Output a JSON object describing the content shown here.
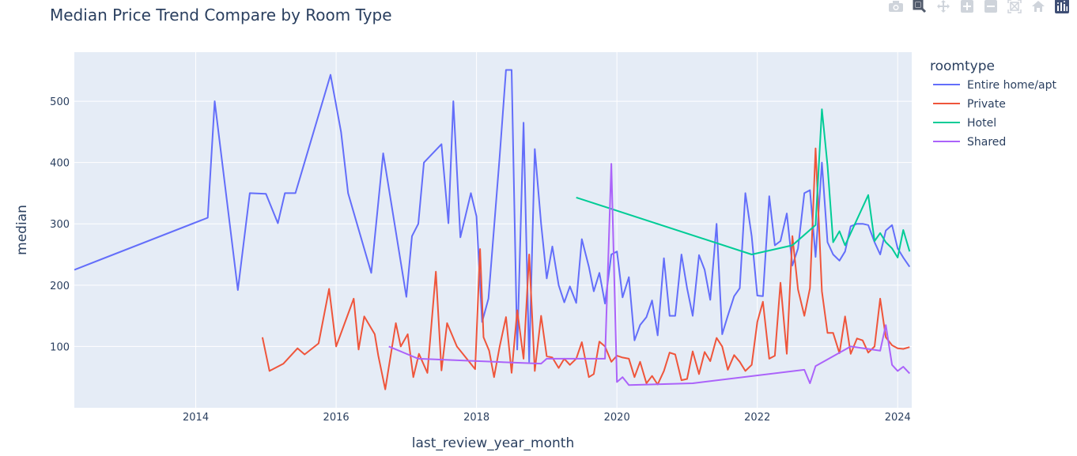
{
  "title": "Median Price Trend Compare by Room Type",
  "modebar": [
    {
      "name": "camera-icon",
      "label": "Download plot as a png"
    },
    {
      "name": "zoom-icon",
      "label": "Zoom"
    },
    {
      "name": "pan-icon",
      "label": "Pan"
    },
    {
      "name": "zoom-in-icon",
      "label": "Zoom in"
    },
    {
      "name": "zoom-out-icon",
      "label": "Zoom out"
    },
    {
      "name": "autoscale-icon",
      "label": "Autoscale"
    },
    {
      "name": "home-icon",
      "label": "Reset axes"
    },
    {
      "name": "plotly-logo-icon",
      "label": "Produced with Plotly"
    }
  ],
  "chart_data": {
    "type": "line",
    "title": "Median Price Trend Compare by Room Type",
    "xlabel": "last_review_year_month",
    "ylabel": "median",
    "xlim": [
      2012.27,
      2024.2
    ],
    "ylim": [
      0,
      580
    ],
    "x_ticks": [
      2014,
      2016,
      2018,
      2020,
      2022,
      2024
    ],
    "y_ticks": [
      100,
      200,
      300,
      400,
      500
    ],
    "grid": true,
    "legend_title": "roomtype",
    "legend_position": "right",
    "series": [
      {
        "name": "Entire home/apt",
        "color": "#636efa",
        "x": [
          2012.27,
          2014.17,
          2014.27,
          2014.6,
          2014.77,
          2015.0,
          2015.17,
          2015.27,
          2015.42,
          2015.92,
          2016.07,
          2016.17,
          2016.5,
          2016.67,
          2017.0,
          2017.08,
          2017.17,
          2017.25,
          2017.5,
          2017.6,
          2017.67,
          2017.77,
          2017.92,
          2018.0,
          2018.08,
          2018.17,
          2018.33,
          2018.42,
          2018.5,
          2018.58,
          2018.67,
          2018.75,
          2018.83,
          2018.92,
          2019.0,
          2019.08,
          2019.17,
          2019.25,
          2019.33,
          2019.42,
          2019.5,
          2019.6,
          2019.67,
          2019.75,
          2019.83,
          2019.92,
          2020.0,
          2020.08,
          2020.17,
          2020.25,
          2020.33,
          2020.42,
          2020.5,
          2020.58,
          2020.67,
          2020.75,
          2020.83,
          2020.92,
          2021.0,
          2021.08,
          2021.17,
          2021.25,
          2021.33,
          2021.42,
          2021.5,
          2021.58,
          2021.67,
          2021.75,
          2021.83,
          2021.92,
          2022.0,
          2022.08,
          2022.17,
          2022.25,
          2022.33,
          2022.42,
          2022.5,
          2022.58,
          2022.67,
          2022.75,
          2022.83,
          2022.92,
          2023.0,
          2023.08,
          2023.17,
          2023.25,
          2023.33,
          2023.42,
          2023.5,
          2023.58,
          2023.67,
          2023.75,
          2023.83,
          2023.92,
          2024.0,
          2024.08,
          2024.17
        ],
        "y": [
          225,
          310,
          500,
          192,
          350,
          349,
          301,
          350,
          350,
          543,
          450,
          350,
          220,
          415,
          181,
          280,
          300,
          400,
          430,
          301,
          500,
          278,
          350,
          312,
          140,
          178,
          410,
          551,
          551,
          95,
          465,
          75,
          422,
          300,
          211,
          263,
          200,
          172,
          198,
          171,
          275,
          230,
          190,
          220,
          170,
          250,
          255,
          180,
          213,
          110,
          135,
          148,
          175,
          118,
          244,
          150,
          150,
          250,
          195,
          150,
          249,
          225,
          176,
          300,
          120,
          150,
          182,
          195,
          350,
          280,
          183,
          182,
          345,
          265,
          272,
          317,
          232,
          260,
          350,
          355,
          246,
          400,
          270,
          250,
          240,
          255,
          296,
          300,
          300,
          298,
          270,
          250,
          289,
          298,
          260,
          245,
          230
        ]
      },
      {
        "name": "Private",
        "color": "#ef553b",
        "x": [
          2014.95,
          2015.05,
          2015.25,
          2015.45,
          2015.55,
          2015.75,
          2015.9,
          2016.0,
          2016.25,
          2016.32,
          2016.4,
          2016.55,
          2016.6,
          2016.7,
          2016.85,
          2016.92,
          2017.02,
          2017.1,
          2017.18,
          2017.3,
          2017.42,
          2017.5,
          2017.58,
          2017.72,
          2017.98,
          2018.05,
          2018.1,
          2018.18,
          2018.25,
          2018.33,
          2018.42,
          2018.5,
          2018.58,
          2018.67,
          2018.75,
          2018.83,
          2018.92,
          2019.0,
          2019.08,
          2019.17,
          2019.25,
          2019.33,
          2019.42,
          2019.5,
          2019.6,
          2019.67,
          2019.75,
          2019.83,
          2019.92,
          2020.0,
          2020.08,
          2020.17,
          2020.25,
          2020.33,
          2020.42,
          2020.5,
          2020.58,
          2020.67,
          2020.75,
          2020.83,
          2020.92,
          2021.0,
          2021.08,
          2021.17,
          2021.25,
          2021.33,
          2021.42,
          2021.5,
          2021.58,
          2021.67,
          2021.75,
          2021.83,
          2021.92,
          2022.0,
          2022.08,
          2022.17,
          2022.25,
          2022.33,
          2022.42,
          2022.5,
          2022.58,
          2022.67,
          2022.75,
          2022.83,
          2022.92,
          2023.0,
          2023.08,
          2023.17,
          2023.25,
          2023.33,
          2023.42,
          2023.5,
          2023.58,
          2023.67,
          2023.75,
          2023.83,
          2023.92,
          2024.0,
          2024.08,
          2024.17
        ],
        "y": [
          115,
          60,
          72,
          97,
          87,
          105,
          194,
          100,
          178,
          95,
          149,
          120,
          85,
          30,
          138,
          100,
          120,
          50,
          88,
          57,
          222,
          61,
          138,
          100,
          63,
          259,
          115,
          93,
          50,
          100,
          148,
          57,
          159,
          80,
          250,
          60,
          150,
          84,
          82,
          65,
          80,
          70,
          80,
          107,
          50,
          55,
          108,
          100,
          75,
          85,
          82,
          80,
          50,
          75,
          40,
          52,
          38,
          60,
          90,
          87,
          45,
          47,
          92,
          55,
          91,
          76,
          114,
          100,
          62,
          86,
          75,
          60,
          70,
          140,
          173,
          80,
          85,
          204,
          88,
          280,
          193,
          150,
          195,
          423,
          190,
          122,
          122,
          89,
          149,
          88,
          113,
          110,
          90,
          100,
          178,
          115,
          102,
          97,
          96,
          99
        ]
      },
      {
        "name": "Hotel",
        "color": "#00cc96",
        "x": [
          2019.42,
          2021.92,
          2022.5,
          2022.83,
          2022.92,
          2023.0,
          2023.08,
          2023.17,
          2023.25,
          2023.58,
          2023.67,
          2023.75,
          2023.83,
          2023.92,
          2024.0,
          2024.08,
          2024.17
        ],
        "y": [
          343,
          250,
          265,
          298,
          487,
          395,
          270,
          288,
          265,
          347,
          272,
          285,
          270,
          260,
          245,
          290,
          255
        ]
      },
      {
        "name": "Shared",
        "color": "#ab63fa",
        "x": [
          2016.75,
          2017.17,
          2018.25,
          2018.92,
          2019.0,
          2019.83,
          2019.92,
          2020.0,
          2020.08,
          2020.17,
          2021.08,
          2022.67,
          2022.75,
          2022.83,
          2023.33,
          2023.75,
          2023.83,
          2023.92,
          2024.0,
          2024.08,
          2024.17
        ],
        "y": [
          100,
          80,
          75,
          72,
          80,
          80,
          398,
          42,
          50,
          37,
          40,
          62,
          40,
          68,
          100,
          93,
          135,
          70,
          60,
          67,
          56
        ]
      }
    ]
  }
}
